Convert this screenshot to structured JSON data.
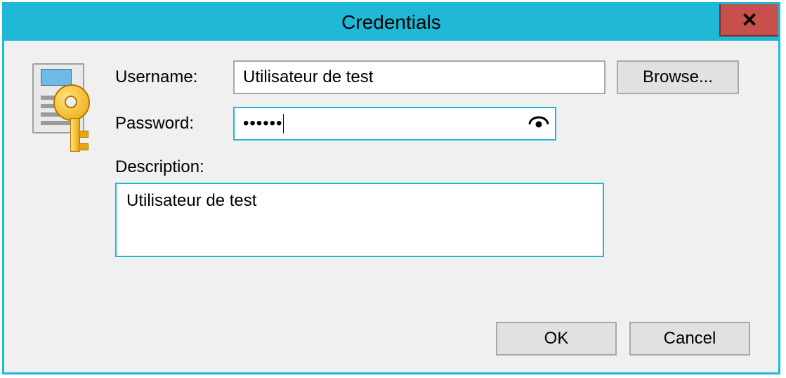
{
  "window": {
    "title": "Credentials"
  },
  "labels": {
    "username": "Username:",
    "password": "Password:",
    "description": "Description:"
  },
  "fields": {
    "username_value": "Utilisateur de test",
    "password_mask": "••••••",
    "description_value": "Utilisateur de test"
  },
  "buttons": {
    "browse": "Browse...",
    "ok": "OK",
    "cancel": "Cancel"
  }
}
